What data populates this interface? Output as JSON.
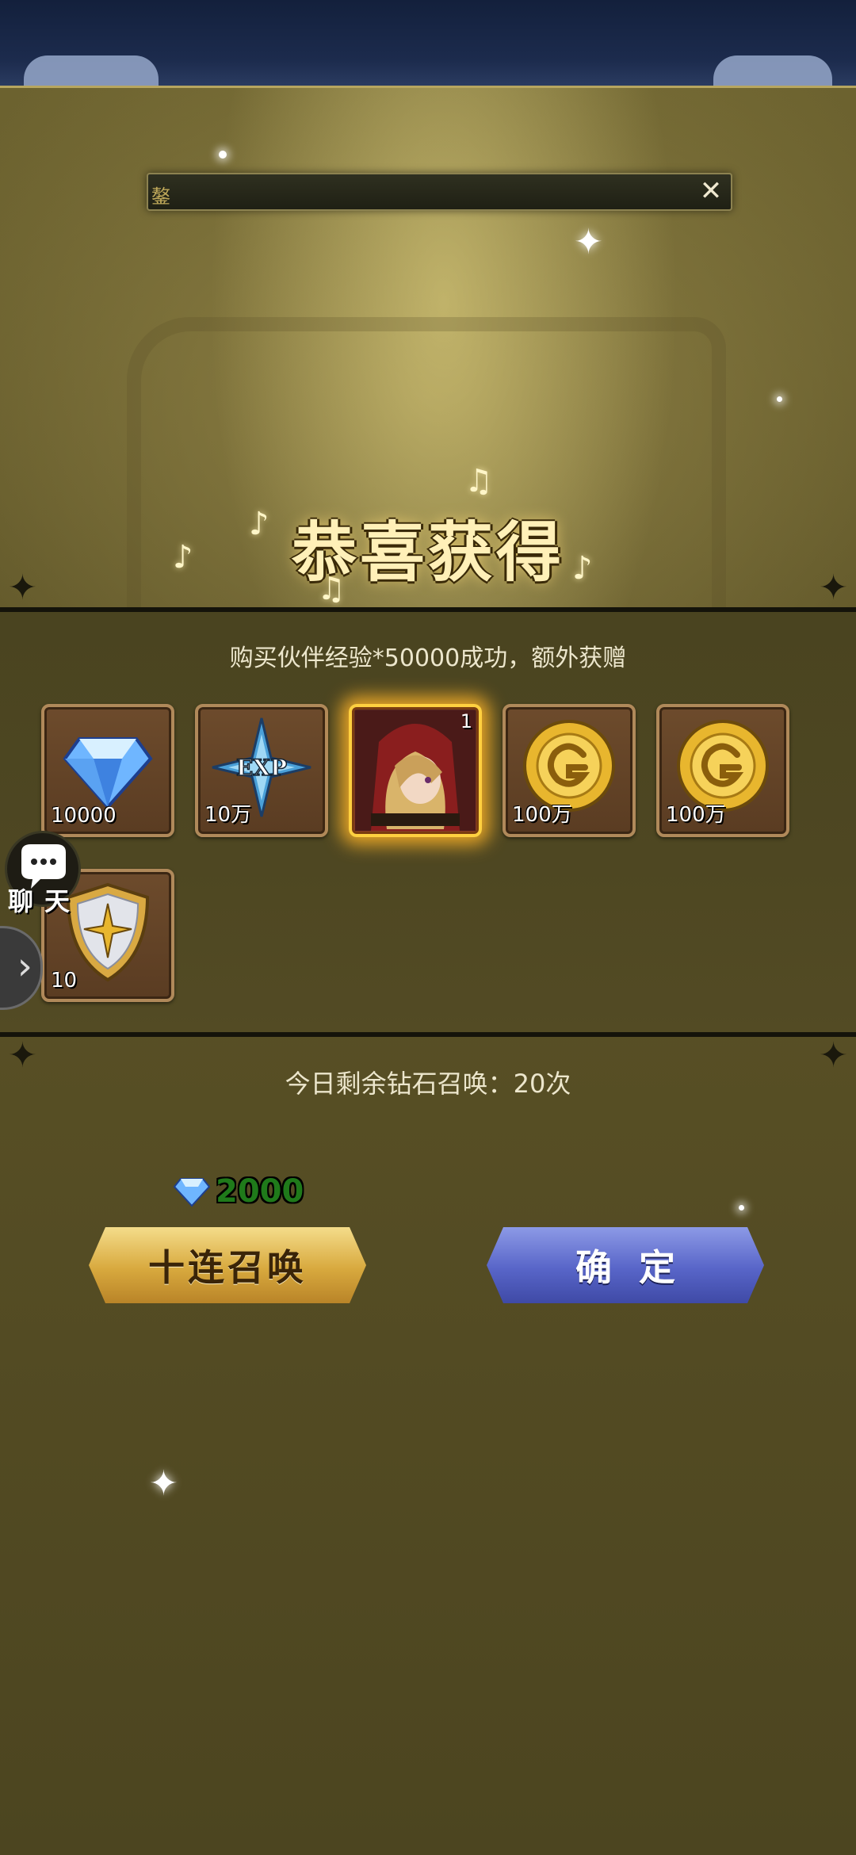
{
  "header": {
    "title_bar_tag": "鏊",
    "close_glyph": "✕"
  },
  "congrats_title": "恭喜获得",
  "reward_message": "购买伙伴经验*50000成功，额外获赠",
  "items": [
    {
      "name": "diamond",
      "count": "10000",
      "icon": "diamond-icon"
    },
    {
      "name": "exp",
      "count": "10万",
      "icon": "exp-star-icon"
    },
    {
      "name": "hero",
      "count": "",
      "badge": "1",
      "icon": "hero-portrait-icon"
    },
    {
      "name": "gold-coin",
      "count": "100万",
      "icon": "gold-coin-icon"
    },
    {
      "name": "gold-coin",
      "count": "100万",
      "icon": "gold-coin-icon"
    },
    {
      "name": "shield",
      "count": "10",
      "icon": "shield-icon"
    }
  ],
  "chat": {
    "label": "聊天"
  },
  "remaining_text": "今日剩余钻石召唤：20次",
  "summon": {
    "cost": "2000",
    "label": "十连召唤"
  },
  "confirm": {
    "label": "确定"
  },
  "colors": {
    "accent_gold": "#d8a93e",
    "accent_blue": "#5865c8",
    "cost_green": "#1f7a1a"
  }
}
